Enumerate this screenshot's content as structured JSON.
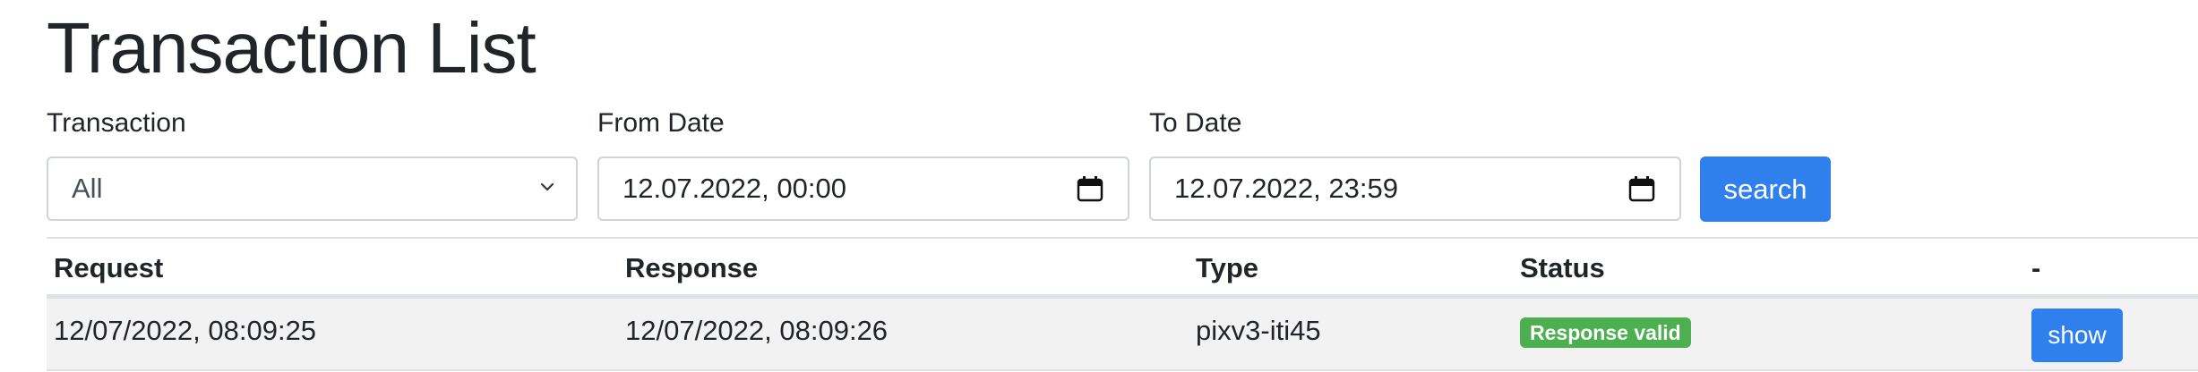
{
  "page": {
    "title": "Transaction List"
  },
  "filters": {
    "transaction": {
      "label": "Transaction",
      "selected": "All"
    },
    "from_date": {
      "label": "From Date",
      "value": "12.07.2022, 00:00"
    },
    "to_date": {
      "label": "To Date",
      "value": "12.07.2022, 23:59"
    },
    "search_label": "search"
  },
  "table": {
    "columns": [
      "Request",
      "Response",
      "Type",
      "Status",
      "-"
    ],
    "rows": [
      {
        "request": "12/07/2022, 08:09:25",
        "response": "12/07/2022, 08:09:26",
        "type": "pixv3-iti45",
        "status": "Response valid",
        "action": "show"
      }
    ]
  },
  "colors": {
    "primary": "#2f80ed",
    "success_badge": "#4caf50",
    "row_stripe": "#f2f2f2",
    "border": "#dee2e6"
  },
  "icons": {
    "select_arrow": "chevron-down-icon",
    "date_picker": "calendar-icon"
  }
}
